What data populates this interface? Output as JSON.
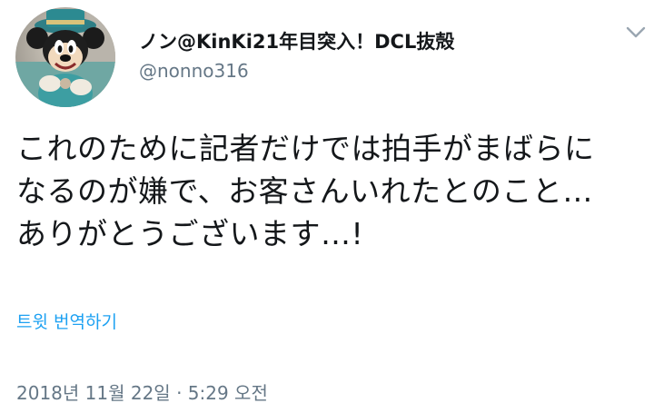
{
  "tweet": {
    "author": {
      "display_name": "ノン@KinKi21年目突入！DCL抜殻",
      "handle": "@nonno316",
      "avatar_icon": "avatar-mickey-icon"
    },
    "menu_icon": "chevron-down-icon",
    "text": "これのために記者だけでは拍手がまばらに\nなるのが嫌で、お客さんいれたとのこと…\nありがとうございます…!",
    "translate_label": "트윗 번역하기",
    "timestamp": "2018년 11월 22일 · 5:29 오전"
  },
  "colors": {
    "text": "#14171a",
    "secondary": "#657786",
    "link": "#1da1f2",
    "background": "#ffffff"
  }
}
